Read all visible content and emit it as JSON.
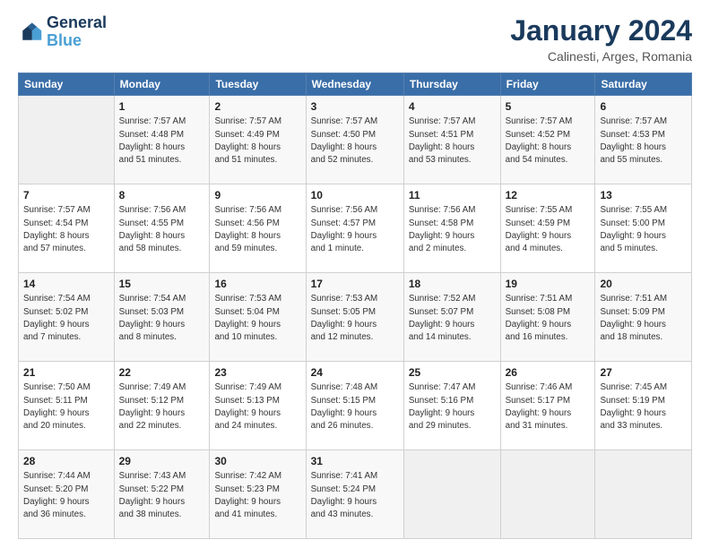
{
  "logo": {
    "line1": "General",
    "line2": "Blue"
  },
  "title": "January 2024",
  "subtitle": "Calinesti, Arges, Romania",
  "header_days": [
    "Sunday",
    "Monday",
    "Tuesday",
    "Wednesday",
    "Thursday",
    "Friday",
    "Saturday"
  ],
  "weeks": [
    [
      {
        "day": "",
        "info": ""
      },
      {
        "day": "1",
        "info": "Sunrise: 7:57 AM\nSunset: 4:48 PM\nDaylight: 8 hours\nand 51 minutes."
      },
      {
        "day": "2",
        "info": "Sunrise: 7:57 AM\nSunset: 4:49 PM\nDaylight: 8 hours\nand 51 minutes."
      },
      {
        "day": "3",
        "info": "Sunrise: 7:57 AM\nSunset: 4:50 PM\nDaylight: 8 hours\nand 52 minutes."
      },
      {
        "day": "4",
        "info": "Sunrise: 7:57 AM\nSunset: 4:51 PM\nDaylight: 8 hours\nand 53 minutes."
      },
      {
        "day": "5",
        "info": "Sunrise: 7:57 AM\nSunset: 4:52 PM\nDaylight: 8 hours\nand 54 minutes."
      },
      {
        "day": "6",
        "info": "Sunrise: 7:57 AM\nSunset: 4:53 PM\nDaylight: 8 hours\nand 55 minutes."
      }
    ],
    [
      {
        "day": "7",
        "info": "Sunrise: 7:57 AM\nSunset: 4:54 PM\nDaylight: 8 hours\nand 57 minutes."
      },
      {
        "day": "8",
        "info": "Sunrise: 7:56 AM\nSunset: 4:55 PM\nDaylight: 8 hours\nand 58 minutes."
      },
      {
        "day": "9",
        "info": "Sunrise: 7:56 AM\nSunset: 4:56 PM\nDaylight: 8 hours\nand 59 minutes."
      },
      {
        "day": "10",
        "info": "Sunrise: 7:56 AM\nSunset: 4:57 PM\nDaylight: 9 hours\nand 1 minute."
      },
      {
        "day": "11",
        "info": "Sunrise: 7:56 AM\nSunset: 4:58 PM\nDaylight: 9 hours\nand 2 minutes."
      },
      {
        "day": "12",
        "info": "Sunrise: 7:55 AM\nSunset: 4:59 PM\nDaylight: 9 hours\nand 4 minutes."
      },
      {
        "day": "13",
        "info": "Sunrise: 7:55 AM\nSunset: 5:00 PM\nDaylight: 9 hours\nand 5 minutes."
      }
    ],
    [
      {
        "day": "14",
        "info": "Sunrise: 7:54 AM\nSunset: 5:02 PM\nDaylight: 9 hours\nand 7 minutes."
      },
      {
        "day": "15",
        "info": "Sunrise: 7:54 AM\nSunset: 5:03 PM\nDaylight: 9 hours\nand 8 minutes."
      },
      {
        "day": "16",
        "info": "Sunrise: 7:53 AM\nSunset: 5:04 PM\nDaylight: 9 hours\nand 10 minutes."
      },
      {
        "day": "17",
        "info": "Sunrise: 7:53 AM\nSunset: 5:05 PM\nDaylight: 9 hours\nand 12 minutes."
      },
      {
        "day": "18",
        "info": "Sunrise: 7:52 AM\nSunset: 5:07 PM\nDaylight: 9 hours\nand 14 minutes."
      },
      {
        "day": "19",
        "info": "Sunrise: 7:51 AM\nSunset: 5:08 PM\nDaylight: 9 hours\nand 16 minutes."
      },
      {
        "day": "20",
        "info": "Sunrise: 7:51 AM\nSunset: 5:09 PM\nDaylight: 9 hours\nand 18 minutes."
      }
    ],
    [
      {
        "day": "21",
        "info": "Sunrise: 7:50 AM\nSunset: 5:11 PM\nDaylight: 9 hours\nand 20 minutes."
      },
      {
        "day": "22",
        "info": "Sunrise: 7:49 AM\nSunset: 5:12 PM\nDaylight: 9 hours\nand 22 minutes."
      },
      {
        "day": "23",
        "info": "Sunrise: 7:49 AM\nSunset: 5:13 PM\nDaylight: 9 hours\nand 24 minutes."
      },
      {
        "day": "24",
        "info": "Sunrise: 7:48 AM\nSunset: 5:15 PM\nDaylight: 9 hours\nand 26 minutes."
      },
      {
        "day": "25",
        "info": "Sunrise: 7:47 AM\nSunset: 5:16 PM\nDaylight: 9 hours\nand 29 minutes."
      },
      {
        "day": "26",
        "info": "Sunrise: 7:46 AM\nSunset: 5:17 PM\nDaylight: 9 hours\nand 31 minutes."
      },
      {
        "day": "27",
        "info": "Sunrise: 7:45 AM\nSunset: 5:19 PM\nDaylight: 9 hours\nand 33 minutes."
      }
    ],
    [
      {
        "day": "28",
        "info": "Sunrise: 7:44 AM\nSunset: 5:20 PM\nDaylight: 9 hours\nand 36 minutes."
      },
      {
        "day": "29",
        "info": "Sunrise: 7:43 AM\nSunset: 5:22 PM\nDaylight: 9 hours\nand 38 minutes."
      },
      {
        "day": "30",
        "info": "Sunrise: 7:42 AM\nSunset: 5:23 PM\nDaylight: 9 hours\nand 41 minutes."
      },
      {
        "day": "31",
        "info": "Sunrise: 7:41 AM\nSunset: 5:24 PM\nDaylight: 9 hours\nand 43 minutes."
      },
      {
        "day": "",
        "info": ""
      },
      {
        "day": "",
        "info": ""
      },
      {
        "day": "",
        "info": ""
      }
    ]
  ]
}
